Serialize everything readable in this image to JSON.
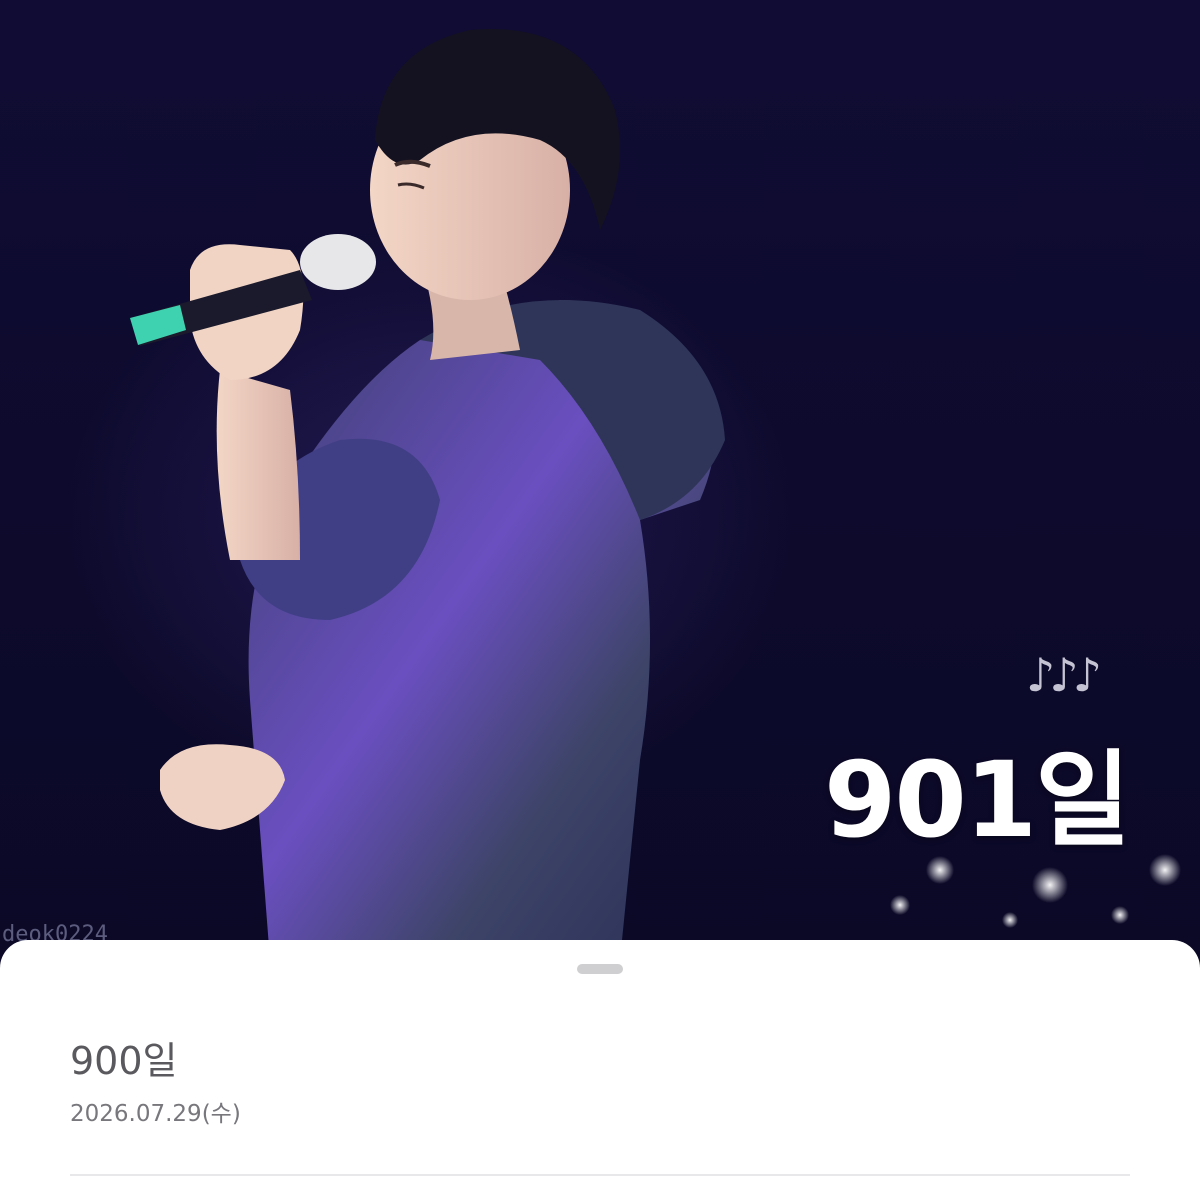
{
  "photo": {
    "overlay_day": "901일",
    "music_notes": "♪♪♪",
    "watermark": "deok0224"
  },
  "sheet": {
    "title": "900일",
    "date": "2026.07.29(수)"
  },
  "colors": {
    "background": "#0e0b2e",
    "sheet": "#ffffff",
    "title_text": "#5a5a5e",
    "date_text": "#77777c"
  }
}
